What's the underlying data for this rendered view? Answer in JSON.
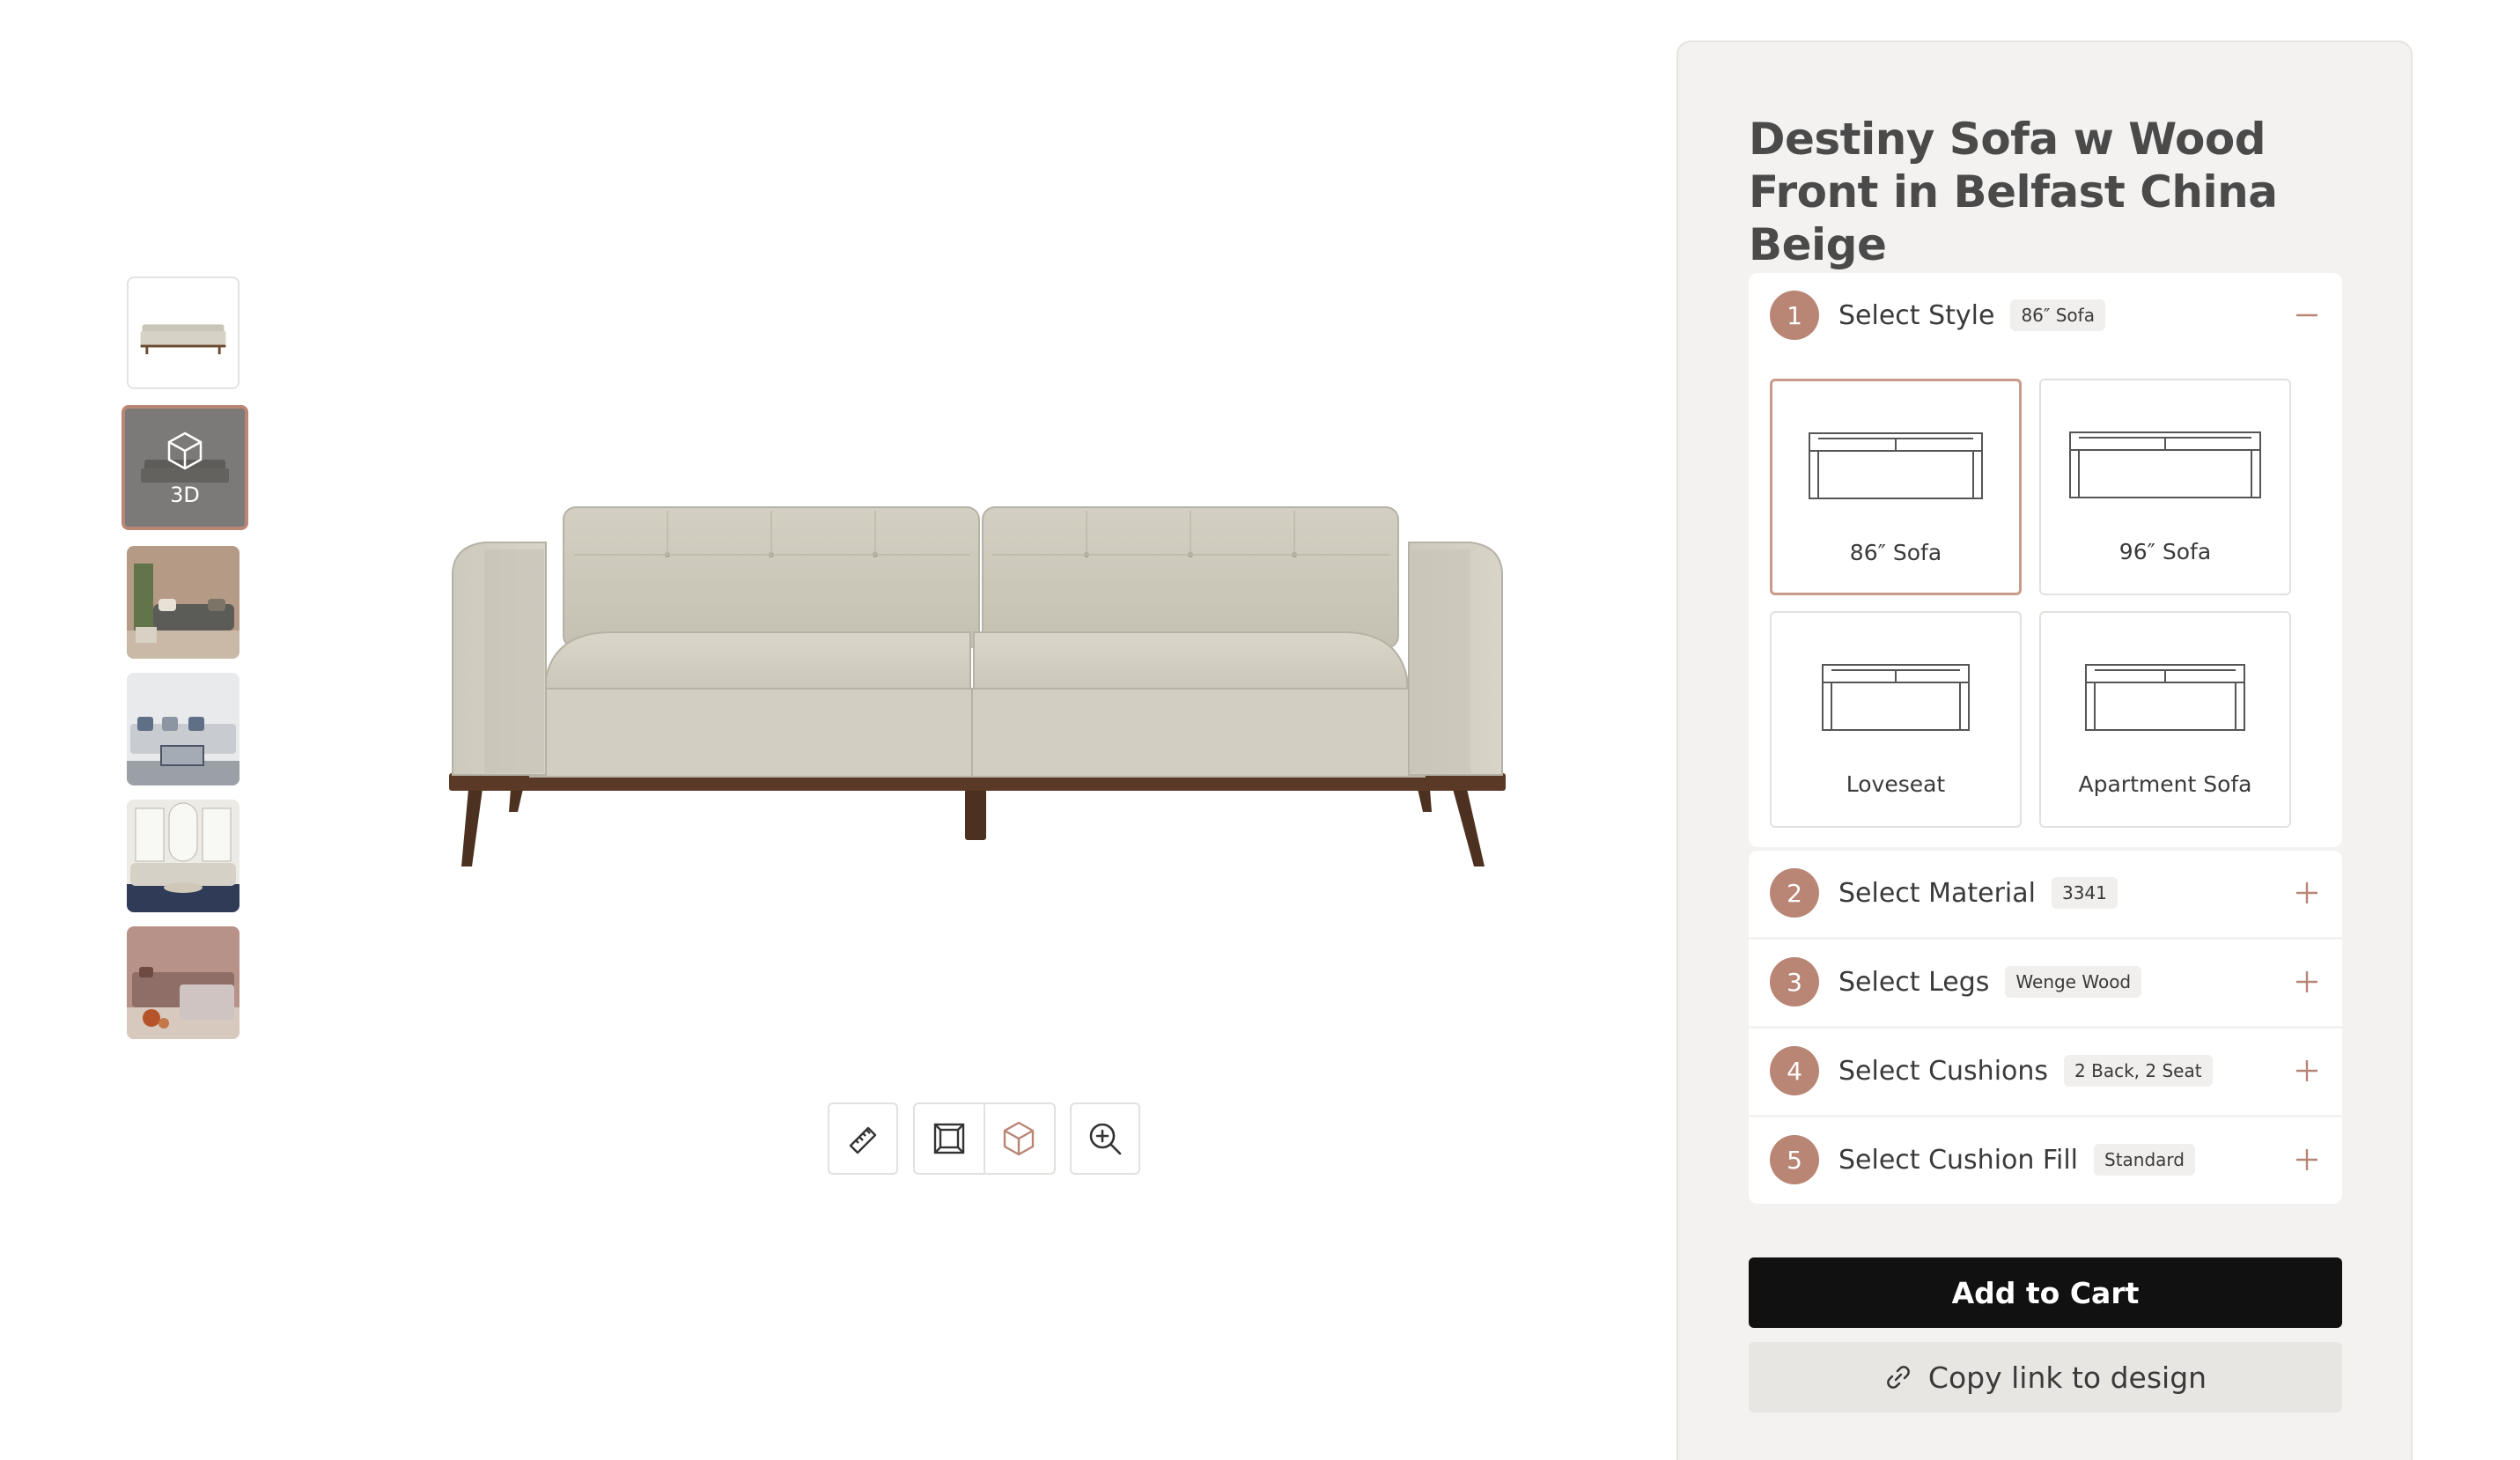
{
  "thumbnails": [
    {
      "name": "sofa-front"
    },
    {
      "name": "sofa-3d",
      "label": "3D"
    },
    {
      "name": "room-scene-1"
    },
    {
      "name": "room-scene-2"
    },
    {
      "name": "room-scene-3"
    },
    {
      "name": "room-scene-4"
    }
  ],
  "toolbar": {
    "buttons": [
      "ruler-icon",
      "frame-icon",
      "cube-icon",
      "zoom-in-icon"
    ]
  },
  "product": {
    "title": "Destiny Sofa w Wood Front in Belfast China Beige"
  },
  "steps": [
    {
      "num": "1",
      "label": "Select Style",
      "value": "86″ Sofa",
      "expanded": true
    },
    {
      "num": "2",
      "label": "Select Material",
      "value": "3341",
      "expanded": false
    },
    {
      "num": "3",
      "label": "Select Legs",
      "value": "Wenge Wood",
      "expanded": false
    },
    {
      "num": "4",
      "label": "Select Cushions",
      "value": "2 Back, 2 Seat",
      "expanded": false
    },
    {
      "num": "5",
      "label": "Select Cushion Fill",
      "value": "Standard",
      "expanded": false
    }
  ],
  "style_options": [
    {
      "label": "86″ Sofa",
      "selected": true
    },
    {
      "label": "96″ Sofa",
      "selected": false
    },
    {
      "label": "Loveseat",
      "selected": false
    },
    {
      "label": "Apartment Sofa",
      "selected": false
    }
  ],
  "actions": {
    "add_to_cart": "Add to Cart",
    "copy_link": "Copy link to design"
  },
  "colors": {
    "accent": "#b98675",
    "panel_bg": "#f3f2f0",
    "cart_bg": "#111111",
    "fabric": "#d4d0c4",
    "wood": "#5a3a26"
  }
}
